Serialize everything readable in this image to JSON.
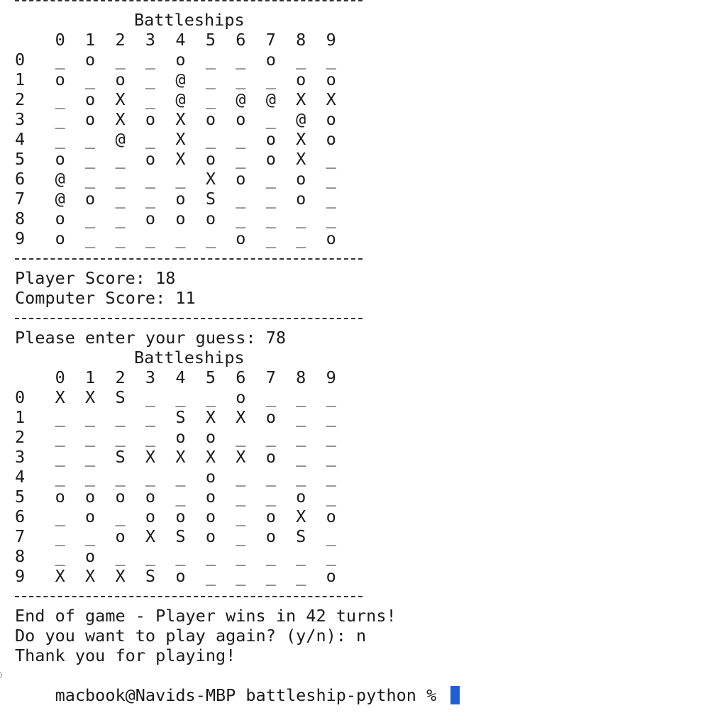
{
  "terminal": {
    "separator": "-----------------------------------",
    "board1": {
      "title": "Battleships",
      "header": "    0  1  2  3  4  5  6  7  8  9",
      "rows": [
        "0   _  o  _  _  o  _  _  o  _  _",
        "1   o  _  o  _  @  _  _  _  o  o",
        "2   _  o  X  _  @  _  @  @  X  X",
        "3   _  o  X  o  X  o  o  _  @  o",
        "4   _  _  @  _  X  _  _  o  X  o",
        "5   o  _  _  o  X  o  _  o  X  _",
        "6   @  _  _  _  _  X  o  _  o  _",
        "7   @  o  _  _  o  S  _  _  o  _",
        "8   o  _  _  o  o  o  _  _  _  _",
        "9   o  _  _  _  _  _  o  _  _  o"
      ]
    },
    "player_score": "Player Score: 18",
    "computer_score": "Computer Score: 11",
    "guess_prompt": "Please enter your guess: 78",
    "board2": {
      "title": "Battleships",
      "header": "    0  1  2  3  4  5  6  7  8  9",
      "rows": [
        "0   X  X  S  _  _  _  o  _  _  _",
        "1   _  _  _  _  S  X  X  o  _  _",
        "2   _  _  _  _  o  o  _  _  _  _",
        "3   _  _  S  X  X  X  X  o  _  _",
        "4   _  _  _  _  _  o  _  _  _  _",
        "5   o  o  o  o  _  o  _  _  o  _",
        "6   _  o  _  o  o  o  _  o  X  o",
        "7   _  _  o  X  S  o  _  o  S  _",
        "8   _  o  _  _  _  _  _  _  _  _",
        "9   X  X  X  S  o  _  _  _  _  o"
      ]
    },
    "end_message": "End of game - Player wins in 42 turns!",
    "play_again_prompt": "Do you want to play again? (y/n): n",
    "thanks_message": "Thank you for playing!",
    "shell_prompt": "macbook@Navids-MBP battleship-python % "
  }
}
